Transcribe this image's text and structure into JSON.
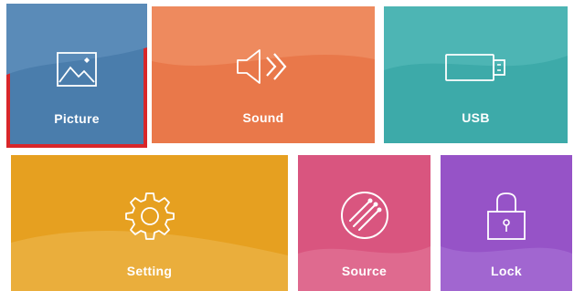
{
  "tiles": [
    {
      "id": "picture",
      "label": "Picture",
      "icon": "picture-icon",
      "color": "#4a7dac",
      "selected": true
    },
    {
      "id": "sound",
      "label": "Sound",
      "icon": "speaker-icon",
      "color": "#e9784a",
      "selected": false
    },
    {
      "id": "usb",
      "label": "USB",
      "icon": "usb-icon",
      "color": "#3daaa9",
      "selected": false
    },
    {
      "id": "setting",
      "label": "Setting",
      "icon": "gear-icon",
      "color": "#e6a020",
      "selected": false
    },
    {
      "id": "source",
      "label": "Source",
      "icon": "source-icon",
      "color": "#d9557f",
      "selected": false
    },
    {
      "id": "lock",
      "label": "Lock",
      "icon": "lock-icon",
      "color": "#9653c7",
      "selected": false
    }
  ],
  "colors": {
    "selection_border": "#d9262a"
  }
}
